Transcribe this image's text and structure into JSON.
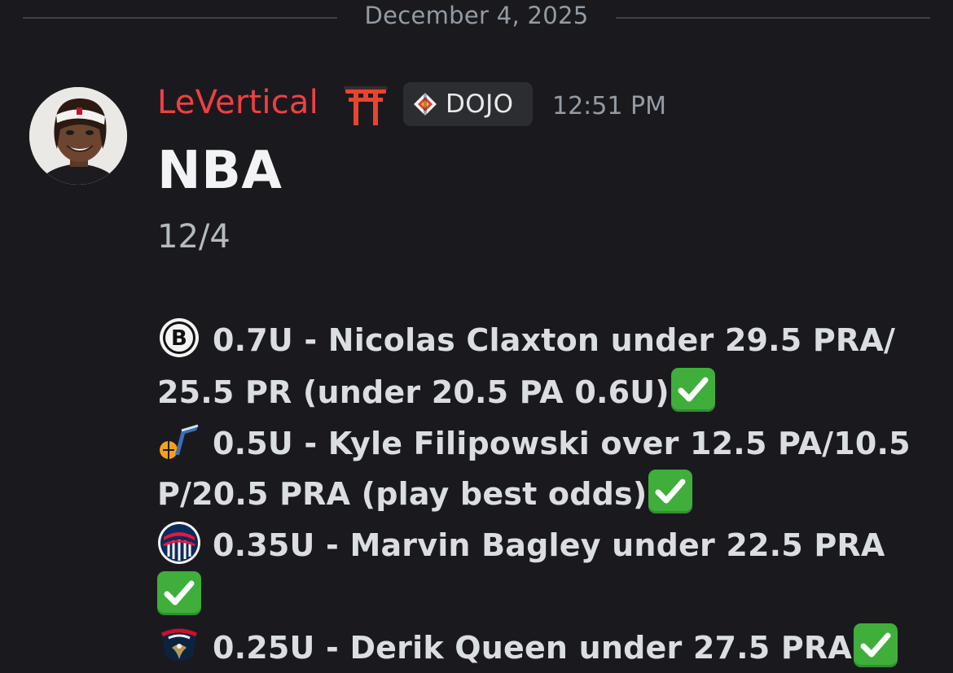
{
  "divider": {
    "date": "December 4, 2025"
  },
  "message": {
    "author": {
      "name": "LeVertical",
      "name_color": "#f23f42",
      "name_emoji": "torii-gate-icon",
      "avatar": "avatar-photo",
      "tag": {
        "icon": "dojo-tag-icon",
        "label": "DOJO"
      }
    },
    "timestamp": "12:51 PM",
    "title": "NBA",
    "date": "12/4",
    "picks": [
      {
        "team_icon": "brooklyn-nets-icon",
        "lines": [
          "0.7U - Nicolas Claxton under 29.5 PRA/",
          "25.5 PR (under 20.5 PA 0.6U)"
        ],
        "result": "check-mark-icon"
      },
      {
        "team_icon": "utah-jazz-icon",
        "lines": [
          "0.5U - Kyle Filipowski over 12.5 PA/10.5",
          "P/20.5 PRA (play best odds)"
        ],
        "result": "check-mark-icon"
      },
      {
        "team_icon": "washington-wizards-icon",
        "lines": [
          "0.35U - Marvin Bagley under 22.5 PRA",
          ""
        ],
        "result": "check-mark-icon"
      },
      {
        "team_icon": "new-orleans-pelicans-icon",
        "lines": [
          "0.25U - Derik Queen under 27.5 PRA"
        ],
        "result": "check-mark-icon"
      }
    ]
  },
  "colors": {
    "background": "#1a1a1e",
    "check_green": "#3fae3b",
    "muted": "#949ba4"
  }
}
